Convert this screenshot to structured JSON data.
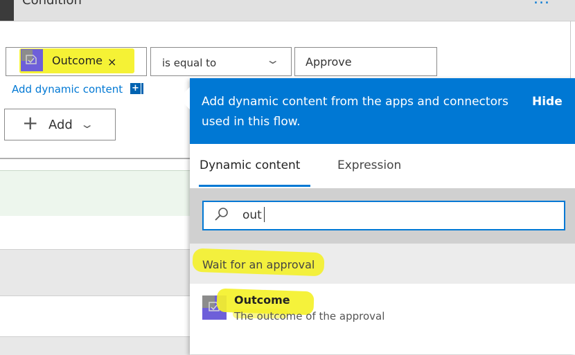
{
  "header": {
    "title": "Condition",
    "menu_label": "..."
  },
  "condition": {
    "token_label": "Outcome",
    "token_remove": "×",
    "operator": "is equal to",
    "value": "Approve"
  },
  "add_dynamic_content": "Add dynamic content",
  "add_dynamic_icon": "+",
  "add_button": {
    "label": "Add",
    "plus": "+"
  },
  "panel": {
    "header_text": "Add dynamic content from the apps and connectors used in this flow.",
    "hide_label": "Hide",
    "tabs": [
      {
        "label": "Dynamic content",
        "active": true
      },
      {
        "label": "Expression",
        "active": false
      }
    ],
    "search_value": "out",
    "group_label": "Wait for an approval",
    "items": [
      {
        "title": "Outcome",
        "description": "The outcome of the approval",
        "icon": "approvals-icon"
      }
    ]
  },
  "colors": {
    "accent": "#0078d4",
    "highlight": "#f4f12a",
    "approvals_icon": "#6e5fd9"
  }
}
